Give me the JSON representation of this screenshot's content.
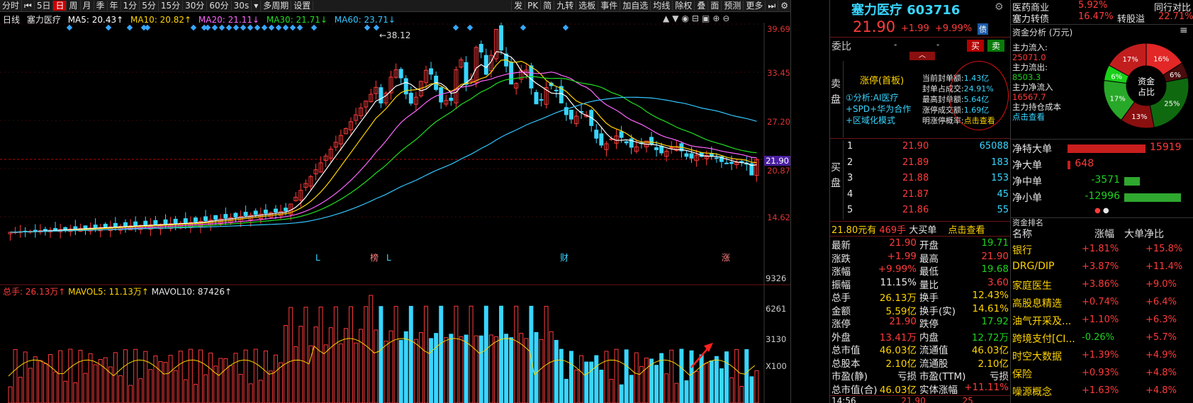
{
  "toolbar": {
    "left_items": [
      "⏮",
      "5日",
      "日",
      "周",
      "月",
      "季",
      "年",
      "1分",
      "5分",
      "15分",
      "30分",
      "60分",
      "30s",
      "▾",
      "多周期",
      "设置"
    ],
    "first_label": "分时",
    "right_items": [
      "发",
      "PK",
      "简",
      "九转",
      "选板",
      "事件",
      "加自选",
      "均线",
      "除权",
      "叠",
      "面",
      "预测",
      "更多",
      "⏭",
      "⚙"
    ]
  },
  "legend": {
    "period": "日线",
    "name": "塞力医疗",
    "ma5": "MA5: 20.43↑",
    "ma10": "MA10: 20.82↑",
    "ma20": "MA20: 21.11↓",
    "ma30": "MA30: 21.71↓",
    "ma60": "MA60: 23.71↓"
  },
  "price_axis": [
    "39.69",
    "33.45",
    "27.20",
    "21.90",
    "20.87",
    "14.62"
  ],
  "peak_label": "←38.12",
  "event_markers": [
    "L",
    "榜",
    "L",
    "财",
    "涨"
  ],
  "vol_legend": {
    "total": "总手: 26.13万↑",
    "mavol5": "MAVOL5: 11.13万↑",
    "mavol10": "MAVOL10: 87426↑"
  },
  "vol_axis": [
    "9326",
    "6261",
    "3130",
    "X100"
  ],
  "stock": {
    "title": "塞力医疗 603716",
    "price": "21.90",
    "change": "+1.99",
    "change_pct": "+9.99%",
    "badge": "债",
    "webi": "委比",
    "dash1": "-",
    "dash2": "-",
    "buy_btn": "买",
    "sell_btn": "卖",
    "sell_side": "卖盘",
    "buy_side": "买盘",
    "zt_label": "涨停(首板)",
    "analysis": "①分析:AI医疗+SPD+华为合作+区域化模式",
    "metrics": [
      {
        "k": "当前封单额:",
        "v": "1.43亿"
      },
      {
        "k": "封单占成交:",
        "v": "24.91%"
      },
      {
        "k": "最高封单额:",
        "v": "5.64亿"
      },
      {
        "k": "涨停成交额:",
        "v": "1.69亿"
      },
      {
        "k": "明涨停概率:",
        "v": "点击查看"
      }
    ],
    "bids": [
      {
        "n": "1",
        "p": "21.90",
        "v": "65088"
      },
      {
        "n": "2",
        "p": "21.89",
        "v": "183"
      },
      {
        "n": "3",
        "p": "21.88",
        "v": "153"
      },
      {
        "n": "4",
        "p": "21.87",
        "v": "45"
      },
      {
        "n": "5",
        "p": "21.86",
        "v": "55"
      }
    ],
    "bid_summary": {
      "price": "21.80元有",
      "vol": "469手",
      "label": "大买单",
      "link": "点击查看"
    },
    "stats": [
      {
        "k1": "最新",
        "v1": "21.90",
        "c1": "red",
        "k2": "开盘",
        "v2": "19.71",
        "c2": "green"
      },
      {
        "k1": "涨跌",
        "v1": "+1.99",
        "c1": "red",
        "k2": "最高",
        "v2": "21.90",
        "c2": "red"
      },
      {
        "k1": "涨幅",
        "v1": "+9.99%",
        "c1": "red",
        "k2": "最低",
        "v2": "19.68",
        "c2": "green"
      },
      {
        "k1": "振幅",
        "v1": "11.15%",
        "c1": "white",
        "k2": "量比",
        "v2": "3.60",
        "c2": "red"
      },
      {
        "k1": "总手",
        "v1": "26.13万",
        "c1": "yellow",
        "k2": "换手",
        "v2": "12.43%",
        "c2": "yellow"
      },
      {
        "k1": "金额",
        "v1": "5.59亿",
        "c1": "yellow",
        "k2": "换手(实)",
        "v2": "14.61%",
        "c2": "yellow"
      },
      {
        "k1": "涨停",
        "v1": "21.90",
        "c1": "red",
        "k2": "跌停",
        "v2": "17.92",
        "c2": "green"
      },
      {
        "k1": "外盘",
        "v1": "13.41万",
        "c1": "red",
        "k2": "内盘",
        "v2": "12.72万",
        "c2": "green"
      },
      {
        "k1": "总市值",
        "v1": "46.03亿",
        "c1": "yellow",
        "k2": "流通值",
        "v2": "46.03亿",
        "c2": "yellow"
      },
      {
        "k1": "总股本",
        "v1": "2.10亿",
        "c1": "yellow",
        "k2": "流通股",
        "v2": "2.10亿",
        "c2": "yellow"
      },
      {
        "k1": "市盈(静)",
        "v1": "亏损",
        "c1": "white",
        "k2": "市盈(TTM)",
        "v2": "亏损",
        "c2": "white"
      },
      {
        "k1": "总市值(合)",
        "v1": "46.03亿",
        "c1": "yellow",
        "k2": "实体涨幅",
        "v2": "+11.11%",
        "c2": "red"
      }
    ],
    "tick": {
      "time": "14:56",
      "price": "21.90",
      "vol": "25"
    }
  },
  "right": {
    "top": [
      {
        "name": "医药商业",
        "pct": "5.92%",
        "extra": "同行对比"
      },
      {
        "name": "塞力转债",
        "pct": "16.47%",
        "label": "转股溢",
        "pct2": "22.71%"
      }
    ],
    "fund_title": "资金分析 (万元)",
    "fund_icon": "≡",
    "fund_rows": [
      {
        "k": "主力流入:",
        "v": "25071.0",
        "c": "red"
      },
      {
        "k": "主力流出:",
        "v": "8503.3",
        "c": "green"
      },
      {
        "k": "主力净流入",
        "v": "16567.7",
        "c": "red"
      },
      {
        "k": "主力持仓成本",
        "v": "点击查看",
        "c": "cyan"
      }
    ],
    "donut": {
      "center1": "资金",
      "center2": "占比",
      "slices": [
        {
          "label": "16%",
          "value": 16,
          "color": "#e32626"
        },
        {
          "label": "6%",
          "value": 6,
          "color": "#4a0c0c"
        },
        {
          "label": "25%",
          "value": 25,
          "color": "#0f6a0f"
        },
        {
          "label": "13%",
          "value": 13,
          "color": "#8a0f0f"
        },
        {
          "label": "17%",
          "value": 17,
          "color": "#28a828"
        },
        {
          "label": "6%",
          "value": 6,
          "color": "#19d019"
        },
        {
          "label": "17%",
          "value": 17,
          "color": "#c21e1e"
        }
      ]
    },
    "flows": [
      {
        "k": "净特大单",
        "v": "15919",
        "ratio": 1.0,
        "c": "red"
      },
      {
        "k": "净大单",
        "v": "648",
        "ratio": 0.04,
        "c": "red"
      },
      {
        "k": "净中单",
        "v": "-3571",
        "ratio": 0.22,
        "c": "green"
      },
      {
        "k": "净小单",
        "v": "-12996",
        "ratio": 0.82,
        "c": "green"
      }
    ],
    "rank_title": "资金排名",
    "rank_headers": [
      "名称",
      "涨幅",
      "大单净比"
    ],
    "rank_rows": [
      {
        "n": "银行",
        "p": "+1.81%",
        "r": "+15.8%"
      },
      {
        "n": "DRG/DIP",
        "p": "+3.87%",
        "r": "+11.4%"
      },
      {
        "n": "家庭医生",
        "p": "+3.86%",
        "r": "+9.0%"
      },
      {
        "n": "高股息精选",
        "p": "+0.74%",
        "r": "+6.4%"
      },
      {
        "n": "油气开采及...",
        "p": "+1.10%",
        "r": "+6.3%"
      },
      {
        "n": "跨境支付[CI...",
        "p": "-0.26%",
        "r": "+5.7%"
      },
      {
        "n": "时空大数据",
        "p": "+1.39%",
        "r": "+4.9%"
      },
      {
        "n": "保险",
        "p": "+0.93%",
        "r": "+4.8%"
      },
      {
        "n": "噪源概念",
        "p": "+1.63%",
        "r": "+4.8%"
      }
    ]
  },
  "colors": {
    "up": "#ff3b3b",
    "down": "#38d6ff",
    "ma5": "#ffffff",
    "ma10": "#ffd400",
    "ma20": "#ff66ff",
    "ma30": "#22dd22",
    "ma60": "#33c7ff"
  }
}
